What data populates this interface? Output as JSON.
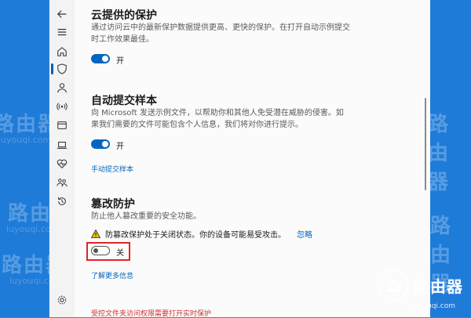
{
  "watermark": {
    "brand_cn": "路由器",
    "url": "luyouqi.com"
  },
  "sections": {
    "cloud": {
      "title": "云提供的保护",
      "description": "通过访问云中的最新保护数据提供更高、更快的保护。在打开自动示例提交时工作效果最佳。",
      "toggle_label": "开",
      "toggle_on": true
    },
    "autosubmit": {
      "title": "自动提交样本",
      "description": "向 Microsoft 发送示例文件，以帮助你和其他人免受潜在威胁的侵害。如果我们需要的文件可能包含个人信息，我们将对你进行提示。",
      "toggle_label": "开",
      "toggle_on": true,
      "manual_link": "手动提交样本"
    },
    "tamper": {
      "title": "篡改防护",
      "description": "防止他人篡改重要的安全功能。",
      "warning": "防篡改保护处于关闭状态。你的设备可能易受攻击。",
      "ignore_link": "忽略",
      "toggle_label": "关",
      "toggle_on": false,
      "learn_more": "了解更多信息"
    }
  },
  "footer_partial": "受控文件夹访问权限需要打开实时保护",
  "colors": {
    "accent": "#0067c0",
    "highlight": "#e1242a",
    "warning": "#f2c200"
  }
}
